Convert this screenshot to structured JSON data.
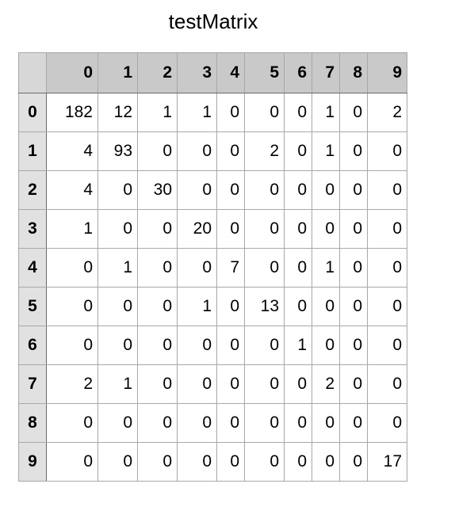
{
  "chart_data": {
    "type": "table",
    "title": "testMatrix",
    "columns": [
      "0",
      "1",
      "2",
      "3",
      "4",
      "5",
      "6",
      "7",
      "8",
      "9"
    ],
    "rows": [
      "0",
      "1",
      "2",
      "3",
      "4",
      "5",
      "6",
      "7",
      "8",
      "9"
    ],
    "values": [
      [
        182,
        12,
        1,
        1,
        0,
        0,
        0,
        1,
        0,
        2
      ],
      [
        4,
        93,
        0,
        0,
        0,
        2,
        0,
        1,
        0,
        0
      ],
      [
        4,
        0,
        30,
        0,
        0,
        0,
        0,
        0,
        0,
        0
      ],
      [
        1,
        0,
        0,
        20,
        0,
        0,
        0,
        0,
        0,
        0
      ],
      [
        0,
        1,
        0,
        0,
        7,
        0,
        0,
        1,
        0,
        0
      ],
      [
        0,
        0,
        0,
        1,
        0,
        13,
        0,
        0,
        0,
        0
      ],
      [
        0,
        0,
        0,
        0,
        0,
        0,
        1,
        0,
        0,
        0
      ],
      [
        2,
        1,
        0,
        0,
        0,
        0,
        0,
        2,
        0,
        0
      ],
      [
        0,
        0,
        0,
        0,
        0,
        0,
        0,
        0,
        0,
        0
      ],
      [
        0,
        0,
        0,
        0,
        0,
        0,
        0,
        0,
        0,
        17
      ]
    ]
  }
}
